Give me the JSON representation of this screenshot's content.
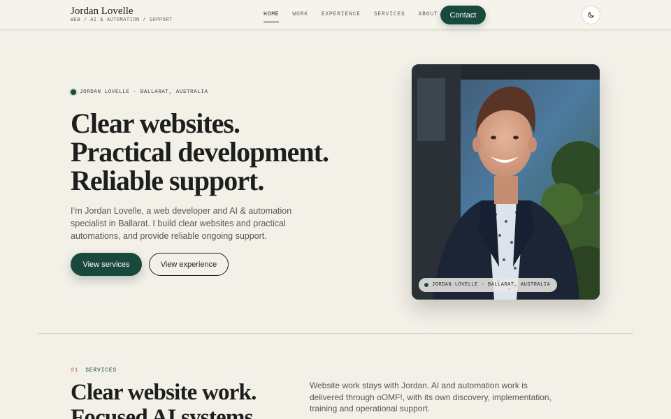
{
  "header": {
    "brand_name": "Jordan Lovelle",
    "brand_tagline": "WEB / AI & AUTOMATION / SUPPORT",
    "nav": [
      {
        "label": "HOME",
        "active": true
      },
      {
        "label": "WORK",
        "active": false
      },
      {
        "label": "EXPERIENCE",
        "active": false
      },
      {
        "label": "SERVICES",
        "active": false
      },
      {
        "label": "ABOUT",
        "active": false
      }
    ],
    "contact_label": "Contact",
    "theme_icon": "moon-icon"
  },
  "hero": {
    "eyebrow": "JORDAN LOVELLE · BALLARAT, AUSTRALIA",
    "headline": [
      "Clear websites.",
      "Practical development.",
      "Reliable support."
    ],
    "intro": "I’m Jordan Lovelle, a web developer and AI & automation specialist in Ballarat. I build clear websites and practical automations, and provide reliable ongoing support.",
    "primary_cta": "View services",
    "secondary_cta": "View experience",
    "portrait_tag": "JORDAN LOVELLE · BALLARAT, AUSTRALIA"
  },
  "services": {
    "number": "01",
    "label": "SERVICES",
    "title": [
      "Clear website work.",
      "Focused AI systems."
    ],
    "description": "Website work stays with Jordan. AI and automation work is delivered through oOMF!, with its own discovery, implementation, training and operational support."
  },
  "colors": {
    "background": "#f3f0e8",
    "accent": "#19493d",
    "text": "#1c1f1d",
    "muted": "#545853",
    "section_number": "#b06a4f"
  }
}
